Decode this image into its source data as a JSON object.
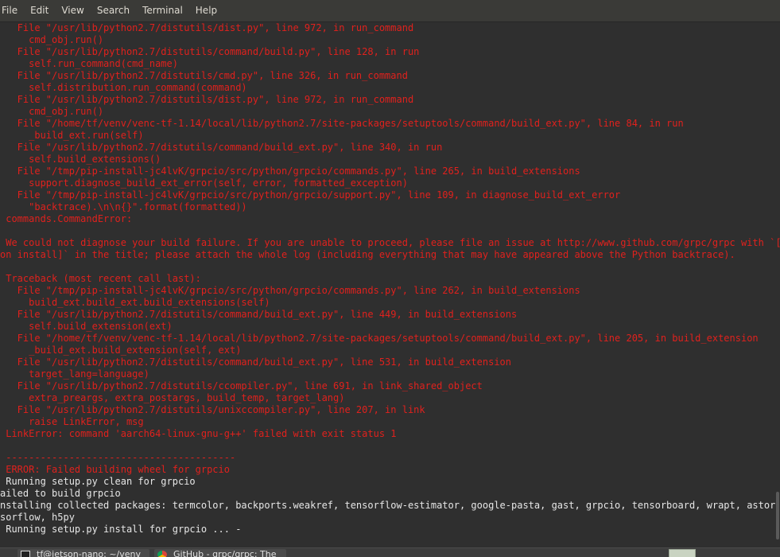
{
  "menubar": {
    "items": [
      "File",
      "Edit",
      "View",
      "Search",
      "Terminal",
      "Help"
    ]
  },
  "terminal": {
    "lines": [
      {
        "text": "   File \"/usr/lib/python2.7/distutils/dist.py\", line 972, in run_command",
        "color": "red"
      },
      {
        "text": "     cmd_obj.run()",
        "color": "red"
      },
      {
        "text": "   File \"/usr/lib/python2.7/distutils/command/build.py\", line 128, in run",
        "color": "red"
      },
      {
        "text": "     self.run_command(cmd_name)",
        "color": "red"
      },
      {
        "text": "   File \"/usr/lib/python2.7/distutils/cmd.py\", line 326, in run_command",
        "color": "red"
      },
      {
        "text": "     self.distribution.run_command(command)",
        "color": "red"
      },
      {
        "text": "   File \"/usr/lib/python2.7/distutils/dist.py\", line 972, in run_command",
        "color": "red"
      },
      {
        "text": "     cmd_obj.run()",
        "color": "red"
      },
      {
        "text": "   File \"/home/tf/venv/venc-tf-1.14/local/lib/python2.7/site-packages/setuptools/command/build_ext.py\", line 84, in run",
        "color": "red"
      },
      {
        "text": "     _build_ext.run(self)",
        "color": "red"
      },
      {
        "text": "   File \"/usr/lib/python2.7/distutils/command/build_ext.py\", line 340, in run",
        "color": "red"
      },
      {
        "text": "     self.build_extensions()",
        "color": "red"
      },
      {
        "text": "   File \"/tmp/pip-install-jc4lvK/grpcio/src/python/grpcio/commands.py\", line 265, in build_extensions",
        "color": "red"
      },
      {
        "text": "     support.diagnose_build_ext_error(self, error, formatted_exception)",
        "color": "red"
      },
      {
        "text": "   File \"/tmp/pip-install-jc4lvK/grpcio/src/python/grpcio/support.py\", line 109, in diagnose_build_ext_error",
        "color": "red"
      },
      {
        "text": "     \"backtrace).\\n\\n{}\".format(formatted))",
        "color": "red"
      },
      {
        "text": " commands.CommandError:",
        "color": "red"
      },
      {
        "text": "",
        "color": "red"
      },
      {
        "text": " We could not diagnose your build failure. If you are unable to proceed, please file an issue at http://www.github.com/grpc/grpc with `[Pyt",
        "color": "red"
      },
      {
        "text": "on install]` in the title; please attach the whole log (including everything that may have appeared above the Python backtrace).",
        "color": "red"
      },
      {
        "text": "",
        "color": "red"
      },
      {
        "text": " Traceback (most recent call last):",
        "color": "red"
      },
      {
        "text": "   File \"/tmp/pip-install-jc4lvK/grpcio/src/python/grpcio/commands.py\", line 262, in build_extensions",
        "color": "red"
      },
      {
        "text": "     build_ext.build_ext.build_extensions(self)",
        "color": "red"
      },
      {
        "text": "   File \"/usr/lib/python2.7/distutils/command/build_ext.py\", line 449, in build_extensions",
        "color": "red"
      },
      {
        "text": "     self.build_extension(ext)",
        "color": "red"
      },
      {
        "text": "   File \"/home/tf/venv/venc-tf-1.14/local/lib/python2.7/site-packages/setuptools/command/build_ext.py\", line 205, in build_extension",
        "color": "red"
      },
      {
        "text": "     _build_ext.build_extension(self, ext)",
        "color": "red"
      },
      {
        "text": "   File \"/usr/lib/python2.7/distutils/command/build_ext.py\", line 531, in build_extension",
        "color": "red"
      },
      {
        "text": "     target_lang=language)",
        "color": "red"
      },
      {
        "text": "   File \"/usr/lib/python2.7/distutils/ccompiler.py\", line 691, in link_shared_object",
        "color": "red"
      },
      {
        "text": "     extra_preargs, extra_postargs, build_temp, target_lang)",
        "color": "red"
      },
      {
        "text": "   File \"/usr/lib/python2.7/distutils/unixccompiler.py\", line 207, in link",
        "color": "red"
      },
      {
        "text": "     raise LinkError, msg",
        "color": "red"
      },
      {
        "text": " LinkError: command 'aarch64-linux-gnu-g++' failed with exit status 1",
        "color": "red"
      },
      {
        "text": "",
        "color": "red"
      },
      {
        "text": " ----------------------------------------",
        "color": "red"
      },
      {
        "text": " ERROR: Failed building wheel for grpcio",
        "color": "red"
      },
      {
        "text": " Running setup.py clean for grpcio",
        "color": "white"
      },
      {
        "text": "ailed to build grpcio",
        "color": "white"
      },
      {
        "text": "nstalling collected packages: termcolor, backports.weakref, tensorflow-estimator, google-pasta, gast, grpcio, tensorboard, wrapt, astor, te",
        "color": "white"
      },
      {
        "text": "sorflow, h5py",
        "color": "white"
      },
      {
        "text": " Running setup.py install for grpcio ... -",
        "color": "white"
      }
    ]
  },
  "taskbar": {
    "tasks": [
      {
        "label": "tf@jetson-nano: ~/venv",
        "icon": "terminal-icon"
      },
      {
        "label": "GitHub - grpc/grpc: The",
        "icon": "chrome-icon"
      }
    ]
  }
}
